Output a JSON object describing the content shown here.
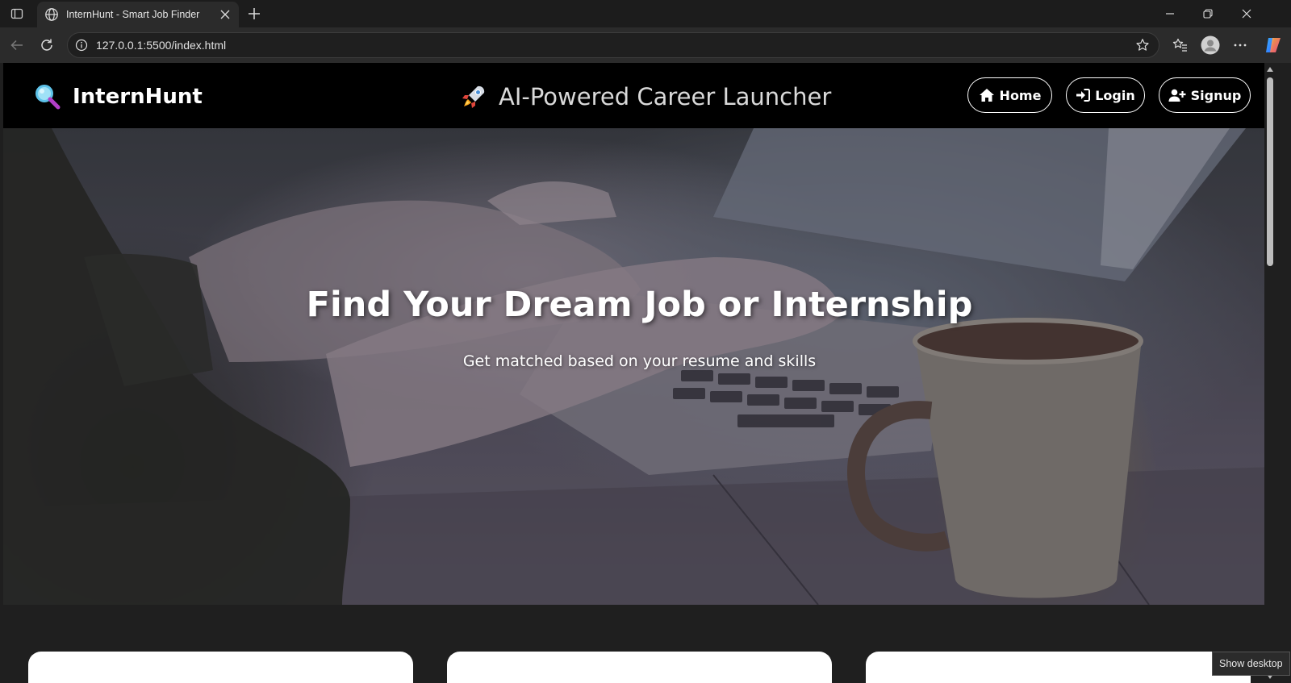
{
  "browser": {
    "tab_title": "InternHunt - Smart Job Finder",
    "url": "127.0.0.1:5500/index.html",
    "icons": [
      "tab-actions-icon",
      "globe-icon",
      "close-icon",
      "plus-icon",
      "minimize-icon",
      "restore-icon",
      "window-close-icon",
      "back-icon",
      "refresh-icon",
      "info-icon",
      "star-icon",
      "favorites-icon",
      "profile-icon",
      "more-icon",
      "copilot-icon"
    ]
  },
  "header": {
    "brand_name": "InternHunt",
    "brand_icon": "magnifier-icon",
    "tagline": "AI-Powered Career Launcher",
    "tagline_icon": "rocket-icon",
    "nav": {
      "home": "Home",
      "login": "Login",
      "signup": "Signup"
    }
  },
  "hero": {
    "title": "Find Your Dream Job or Internship",
    "subtitle": "Get matched based on your resume and skills"
  },
  "os": {
    "tooltip": "Show desktop"
  },
  "colors": {
    "header_bg": "#000000",
    "page_bg": "#1f1f1f",
    "chrome_bg": "#2b2b2b"
  }
}
